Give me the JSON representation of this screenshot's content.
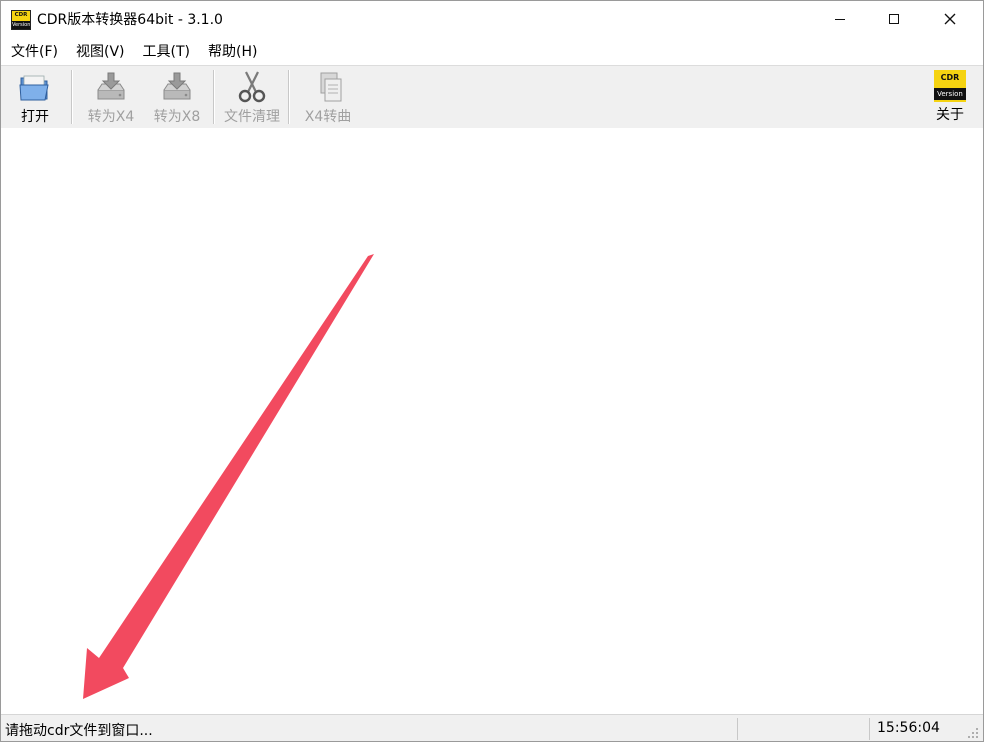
{
  "window": {
    "title": "CDR版本转换器64bit - 3.1.0",
    "icon": {
      "top_text": "CDR",
      "bottom_text": "Version"
    },
    "controls": [
      "minimize-icon",
      "maximize-icon",
      "close-icon"
    ]
  },
  "menubar": {
    "items": [
      "文件(F)",
      "视图(V)",
      "工具(T)",
      "帮助(H)"
    ]
  },
  "toolbar": {
    "buttons": [
      {
        "label": "打开",
        "icon": "open-folder-icon",
        "enabled": true
      },
      {
        "label": "转为X4",
        "icon": "convert-drive-icon",
        "enabled": false
      },
      {
        "label": "转为X8",
        "icon": "convert-drive-icon",
        "enabled": false
      },
      {
        "label": "文件清理",
        "icon": "scissors-icon",
        "enabled": false
      },
      {
        "label": "X4转曲",
        "icon": "copy-pages-icon",
        "enabled": false
      }
    ],
    "about": {
      "label": "关于",
      "logo_top": "CDR",
      "logo_bottom": "Version"
    }
  },
  "annotation": {
    "arrow_color": "#f24a5f"
  },
  "statusbar": {
    "message": "请拖动cdr文件到窗口...",
    "time": "15:56:04"
  }
}
